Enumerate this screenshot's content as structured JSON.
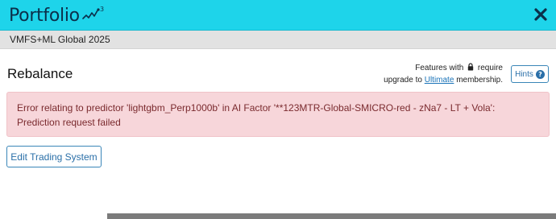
{
  "app": {
    "brand_name": "Portfolio",
    "logo_icon": "portfolio123-runner-logo",
    "close_icon": "close-icon"
  },
  "subheader": {
    "title": "VMFS+ML Global 2025"
  },
  "section": {
    "title": "Rebalance",
    "features_prefix": "Features with",
    "features_suffix": "require",
    "upgrade_prefix": "upgrade to",
    "upgrade_link": "Ultimate",
    "upgrade_suffix": "membership.",
    "hints_label": "Hints",
    "hints_icon_glyph": "?"
  },
  "alert": {
    "message": "Error relating to predictor 'lightgbm_Perp1000b' in AI Factor '**123MTR-Global-SMICRO-red - zNa7 - LT + Vola': Prediction request failed"
  },
  "actions": {
    "edit_trading_system": "Edit Trading System"
  },
  "colors": {
    "topbar": "#1ed4ea",
    "brand_text": "#0b2f4a",
    "subbar": "#e2e2e2",
    "alert_bg": "#f7d6da",
    "alert_text": "#7a2a2e",
    "link": "#1a73b8",
    "button_border": "#3a86b8"
  }
}
